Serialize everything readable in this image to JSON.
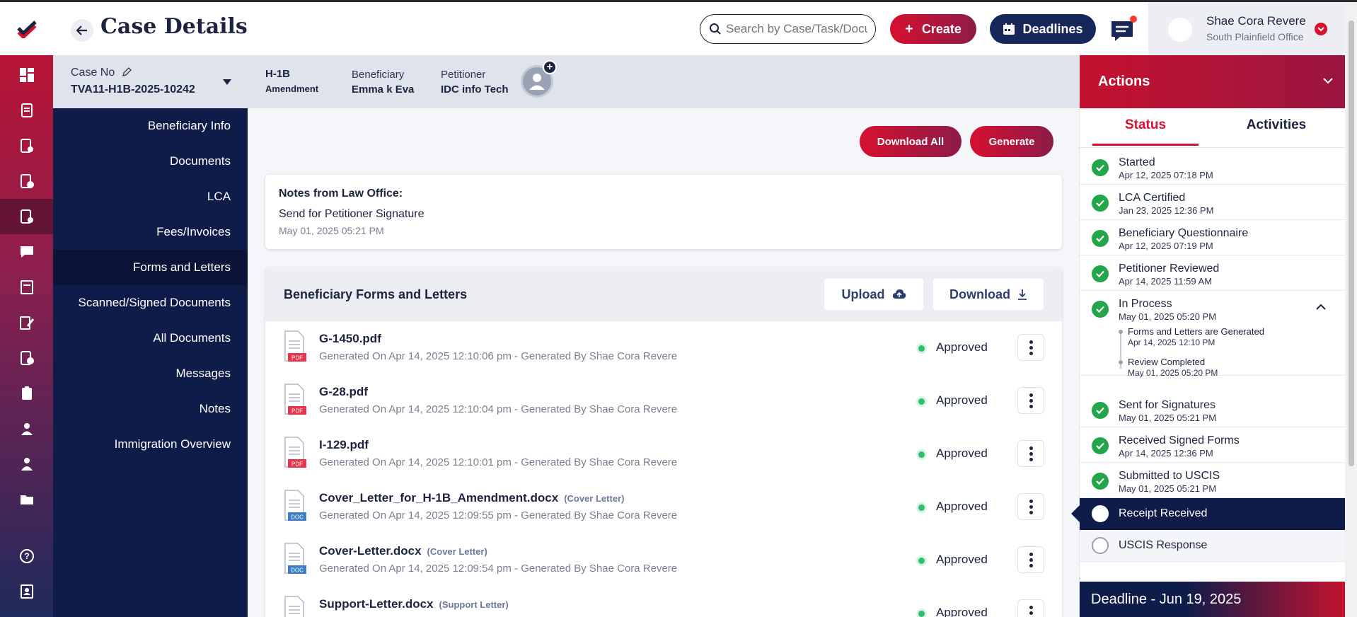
{
  "header": {
    "title": "Case Details",
    "search_placeholder": "Search by Case/Task/Document",
    "create_label": "Create",
    "deadlines_label": "Deadlines",
    "user_name": "Shae Cora Revere",
    "user_office": "South Plainfield Office"
  },
  "case_info": {
    "case_no_label": "Case No",
    "case_no": "TVA11-H1B-2025-10242",
    "visa_type": "H-1B",
    "visa_subtype": "Amendment",
    "beneficiary_label": "Beneficiary",
    "beneficiary": "Emma k Eva",
    "petitioner_label": "Petitioner",
    "petitioner": "IDC info Tech"
  },
  "sidebar": {
    "items": [
      {
        "label": "Beneficiary Info"
      },
      {
        "label": "Documents"
      },
      {
        "label": "LCA"
      },
      {
        "label": "Fees/Invoices"
      },
      {
        "label": "Forms and Letters"
      },
      {
        "label": "Scanned/Signed Documents"
      },
      {
        "label": "All Documents"
      },
      {
        "label": "Messages"
      },
      {
        "label": "Notes"
      },
      {
        "label": "Immigration Overview"
      }
    ],
    "active_index": 4
  },
  "toolbar": {
    "download_all_label": "Download All",
    "generate_label": "Generate"
  },
  "notes": {
    "title": "Notes from Law Office:",
    "text": "Send for Petitioner Signature",
    "date": "May 01, 2025 05:21 PM"
  },
  "forms": {
    "title": "Beneficiary Forms and Letters",
    "upload_label": "Upload",
    "download_label": "Download",
    "rows": [
      {
        "name": "G-1450.pdf",
        "tag": "",
        "type": "PDF",
        "meta": "Generated On Apr 14, 2025 12:10:06 pm - Generated By Shae Cora Revere",
        "status": "Approved"
      },
      {
        "name": "G-28.pdf",
        "tag": "",
        "type": "PDF",
        "meta": "Generated On Apr 14, 2025 12:10:04 pm - Generated By Shae Cora Revere",
        "status": "Approved"
      },
      {
        "name": "I-129.pdf",
        "tag": "",
        "type": "PDF",
        "meta": "Generated On Apr 14, 2025 12:10:01 pm - Generated By Shae Cora Revere",
        "status": "Approved"
      },
      {
        "name": "Cover_Letter_for_H-1B_Amendment.docx",
        "tag": "(Cover Letter)",
        "type": "DOC",
        "meta": "Generated On Apr 14, 2025 12:09:55 pm - Generated By Shae Cora Revere",
        "status": "Approved"
      },
      {
        "name": "Cover-Letter.docx",
        "tag": "(Cover Letter)",
        "type": "DOC",
        "meta": "Generated On Apr 14, 2025 12:09:54 pm - Generated By Shae Cora Revere",
        "status": "Approved"
      },
      {
        "name": "Support-Letter.docx",
        "tag": "(Support Letter)",
        "type": "DOC",
        "meta": "",
        "status": "Approved"
      }
    ]
  },
  "actions": {
    "title": "Actions",
    "tab_status": "Status",
    "tab_activities": "Activities",
    "statuses": [
      {
        "title": "Started",
        "date": "Apr 12, 2025 07:18 PM"
      },
      {
        "title": "LCA Certified",
        "date": "Jan 23, 2025 12:36 PM"
      },
      {
        "title": "Beneficiary Questionnaire",
        "date": "Apr 12, 2025 07:19 PM"
      },
      {
        "title": "Petitioner Reviewed",
        "date": "Apr 14, 2025 11:59 AM"
      }
    ],
    "in_process": {
      "title": "In Process",
      "date": "May 01, 2025 05:20 PM",
      "sub": [
        {
          "title": "Forms and Letters are Generated",
          "date": "Apr 14, 2025 12:10 PM"
        },
        {
          "title": "Review Completed",
          "date": "May 01, 2025 05:20 PM"
        }
      ]
    },
    "statuses_after": [
      {
        "title": "Sent for Signatures",
        "date": "May 01, 2025 05:21 PM"
      },
      {
        "title": "Received Signed Forms",
        "date": "Apr 14, 2025 12:36 PM"
      },
      {
        "title": "Submitted to USCIS",
        "date": "May 01, 2025 05:21 PM"
      }
    ],
    "receipt_label": "Receipt Received",
    "uscis_label": "USCIS Response",
    "deadline": "Deadline - Jun 19, 2025"
  },
  "colors": {
    "brand_red": "#d6102f",
    "navy": "#0f1c4a",
    "approved_green": "#2fbf71",
    "check_green": "#23a549"
  },
  "icons": {
    "rail": [
      "dashboard-icon",
      "cases-icon",
      "tasks-icon",
      "invoices-icon",
      "case-check-icon",
      "messages-icon",
      "forms-icon",
      "edit-icon",
      "lca-icon",
      "clipboard-icon",
      "user-icon",
      "team-icon",
      "folder-icon",
      "help-icon",
      "contacts-icon"
    ]
  }
}
